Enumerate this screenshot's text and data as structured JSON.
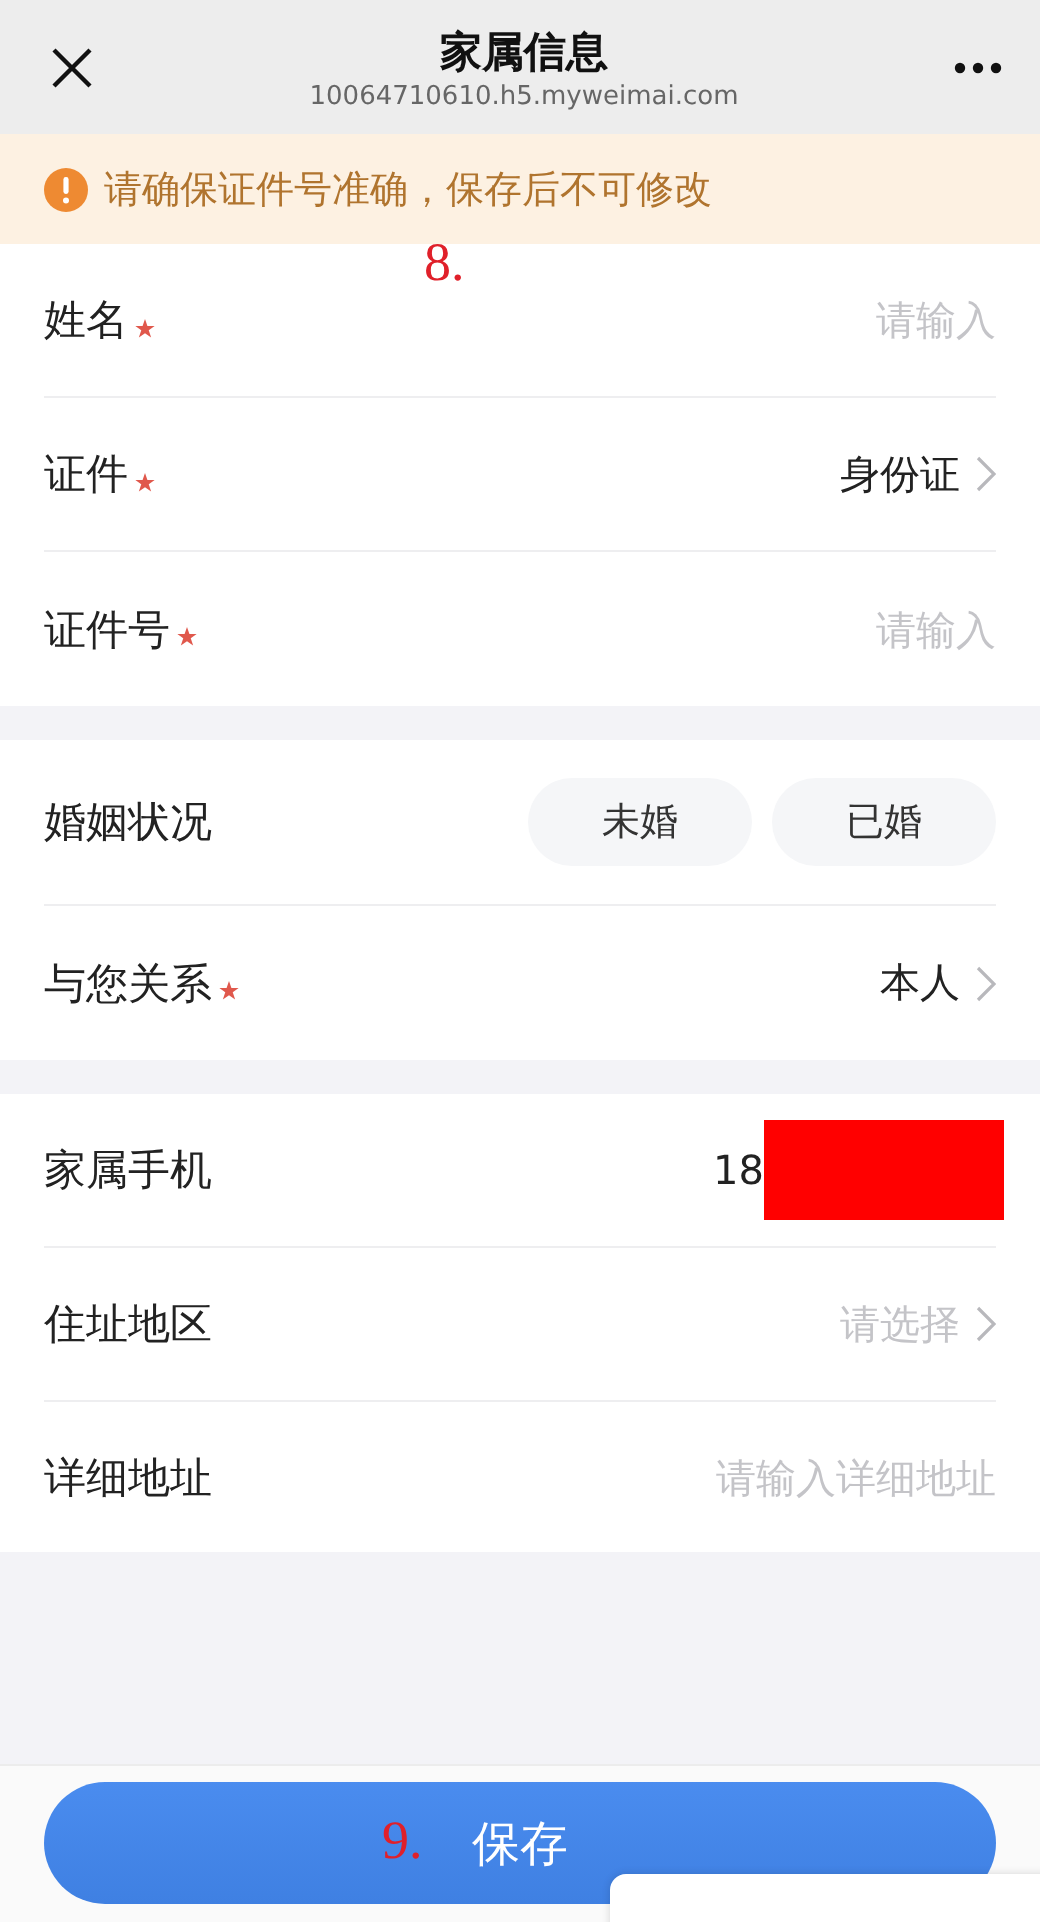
{
  "nav": {
    "title": "家属信息",
    "url": "10064710610.h5.myweimai.com"
  },
  "notice": {
    "text": "请确保证件号准确，保存后不可修改"
  },
  "sections": [
    {
      "rows": [
        {
          "kind": "input",
          "label": "姓名",
          "required": true,
          "placeholder": "请输入"
        },
        {
          "kind": "select",
          "label": "证件",
          "required": true,
          "value": "身份证"
        },
        {
          "kind": "input",
          "label": "证件号",
          "required": true,
          "placeholder": "请输入"
        }
      ]
    },
    {
      "rows": [
        {
          "kind": "chips",
          "label": "婚姻状况",
          "required": false,
          "options": [
            {
              "label": "未婚",
              "selected": false
            },
            {
              "label": "已婚",
              "selected": false
            }
          ]
        },
        {
          "kind": "select",
          "label": "与您关系",
          "required": true,
          "value": "本人"
        }
      ]
    },
    {
      "rows": [
        {
          "kind": "phone",
          "label": "家属手机",
          "required": false,
          "value": "18",
          "redacted": true
        },
        {
          "kind": "select",
          "label": "住址地区",
          "required": false,
          "placeholder": "请选择"
        },
        {
          "kind": "input",
          "label": "详细地址",
          "required": false,
          "placeholder": "请输入详细地址"
        }
      ]
    }
  ],
  "save_button": {
    "label": "保存"
  },
  "annotations": [
    {
      "text": "8."
    },
    {
      "text": "9."
    }
  ]
}
